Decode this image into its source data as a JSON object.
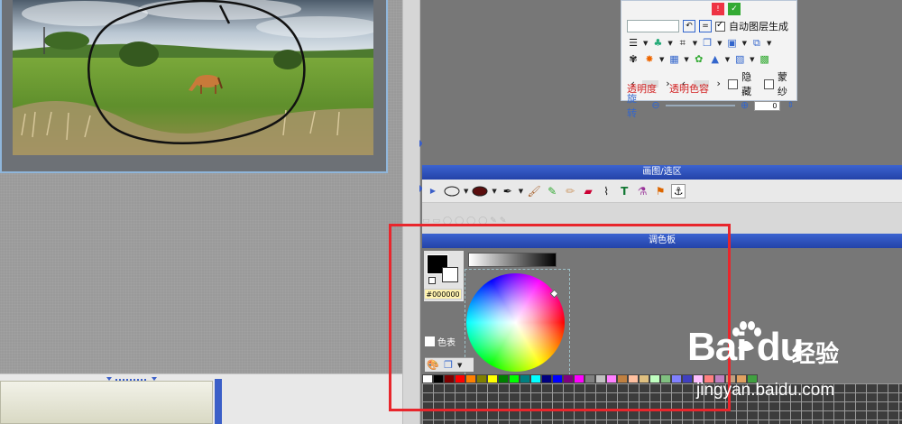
{
  "layers_panel": {
    "auto_layer_label": "自动图层生成",
    "hide_label": "隐藏",
    "mask_label": "蒙纱",
    "transparency_label": "透明度",
    "transparent_color_label": "透明色容",
    "rotate_label": "旋转",
    "rotate_value": "0"
  },
  "draw_panel": {
    "title": "画图/选区",
    "tool_icons": [
      "ellipse-tool-icon",
      "color-fill-icon",
      "pen-icon",
      "brush-icon",
      "marker-icon",
      "pencil-icon",
      "eraser-icon",
      "paint-brush-icon",
      "text-tool-icon",
      "dropper-icon",
      "stamp-icon",
      "anchor-icon"
    ],
    "text_tool_glyph": "T"
  },
  "palette_panel": {
    "title": "调色板",
    "hex_value": "#000000",
    "pixel_label": "色表",
    "swatches": [
      "#ffffff",
      "#000000",
      "#800000",
      "#ff0000",
      "#ff8000",
      "#808000",
      "#ffff00",
      "#008000",
      "#00ff00",
      "#008080",
      "#00ffff",
      "#000080",
      "#0000ff",
      "#800080",
      "#ff00ff",
      "#808080",
      "#c0c0c0",
      "#ff80ff",
      "#c08040",
      "#ffc0a0",
      "#e0c080",
      "#c0ffc0",
      "#80c080",
      "#8080ff",
      "#4040c0",
      "#ffc0ff",
      "#ff8080",
      "#c080c0",
      "#c0a080",
      "#e0a060",
      "#40a040"
    ]
  },
  "watermark": {
    "logo": "Bai du",
    "brand": "经验",
    "url": "jingyan.baidu.com"
  },
  "colors": {
    "panel_title_blue": "#2f52bd",
    "highlight_red": "#e8262c"
  }
}
